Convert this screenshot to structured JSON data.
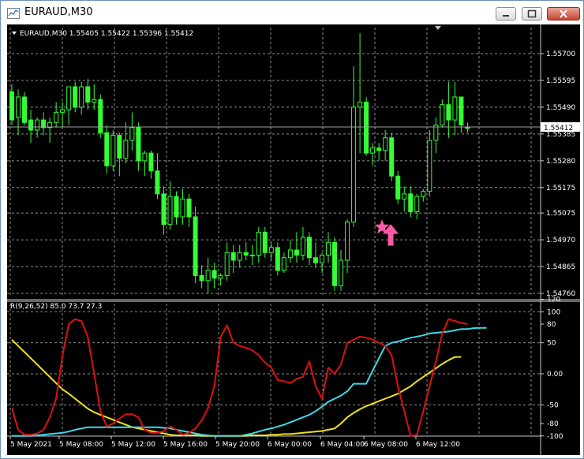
{
  "window": {
    "title": "EURAUD,M30"
  },
  "chart": {
    "header": "EURAUD,M30  1.55405 1.55422 1.55396 1.55412",
    "current_price": "1.55412",
    "price_axis": [
      "1.55700",
      "1.55595",
      "1.55490",
      "1.55385",
      "1.55280",
      "1.55175",
      "1.55075",
      "1.54970",
      "1.54865",
      "1.54760"
    ],
    "time_axis": [
      "5 May 2021",
      "5 May 08:00",
      "5 May 12:00",
      "5 May 16:00",
      "5 May 20:00",
      "6 May 00:00",
      "6 May 04:00",
      "6 May 08:00",
      "6 May 12:00"
    ]
  },
  "indicator": {
    "header": "R(9,26,52) 85.0 73.7 27.3",
    "axis": [
      "120",
      "100",
      "80",
      "50",
      "0.00",
      "-50",
      "-80",
      "-100"
    ]
  },
  "colors": {
    "background": "#000000",
    "candle": "#33ff33",
    "grid": "#8f8f8f",
    "red_line": "#e01010",
    "cyan_line": "#40d8e8",
    "yellow_line": "#f0e020",
    "marker": "#ff5aa8"
  },
  "icons": {
    "marker_star": "star-icon",
    "marker_arrow": "up-arrow-icon"
  },
  "candles": [
    [
      1.5555,
      1.5558,
      1.5542,
      1.5544
    ],
    [
      1.5545,
      1.5556,
      1.5538,
      1.5553
    ],
    [
      1.5553,
      1.5555,
      1.5542,
      1.5543
    ],
    [
      1.5544,
      1.5548,
      1.5535,
      1.554
    ],
    [
      1.554,
      1.5545,
      1.5537,
      1.5544
    ],
    [
      1.5544,
      1.5547,
      1.5538,
      1.5541
    ],
    [
      1.5541,
      1.5545,
      1.5535,
      1.5543
    ],
    [
      1.5543,
      1.5551,
      1.5541,
      1.5547
    ],
    [
      1.5547,
      1.5551,
      1.5541,
      1.5548
    ],
    [
      1.5548,
      1.5556,
      1.5542,
      1.5557
    ],
    [
      1.5557,
      1.5559,
      1.5547,
      1.5549
    ],
    [
      1.5549,
      1.5559,
      1.5546,
      1.5557
    ],
    [
      1.5557,
      1.556,
      1.5548,
      1.5551
    ],
    [
      1.5551,
      1.5558,
      1.5548,
      1.5552
    ],
    [
      1.5552,
      1.5554,
      1.5537,
      1.5539
    ],
    [
      1.5539,
      1.5542,
      1.5523,
      1.5526
    ],
    [
      1.5526,
      1.554,
      1.5524,
      1.5538
    ],
    [
      1.5538,
      1.5539,
      1.5522,
      1.5529
    ],
    [
      1.5529,
      1.5543,
      1.5527,
      1.5536
    ],
    [
      1.5536,
      1.5547,
      1.5532,
      1.5541
    ],
    [
      1.5541,
      1.5543,
      1.5524,
      1.5528
    ],
    [
      1.5528,
      1.5532,
      1.5522,
      1.5531
    ],
    [
      1.5531,
      1.5532,
      1.5521,
      1.5524
    ],
    [
      1.5524,
      1.5531,
      1.5513,
      1.5515
    ],
    [
      1.5515,
      1.5518,
      1.5499,
      1.5503
    ],
    [
      1.5503,
      1.552,
      1.5501,
      1.5514
    ],
    [
      1.5514,
      1.5516,
      1.5503,
      1.5506
    ],
    [
      1.5506,
      1.5517,
      1.5503,
      1.5513
    ],
    [
      1.5513,
      1.5515,
      1.5502,
      1.5506
    ],
    [
      1.5506,
      1.551,
      1.548,
      1.5483
    ],
    [
      1.5483,
      1.5487,
      1.5478,
      1.5481
    ],
    [
      1.5481,
      1.549,
      1.5476,
      1.5485
    ],
    [
      1.5485,
      1.5488,
      1.5478,
      1.5482
    ],
    [
      1.5482,
      1.5484,
      1.5479,
      1.5483
    ],
    [
      1.5483,
      1.5496,
      1.5481,
      1.5492
    ],
    [
      1.5492,
      1.5495,
      1.5484,
      1.5489
    ],
    [
      1.5489,
      1.5495,
      1.5486,
      1.5492
    ],
    [
      1.5492,
      1.5496,
      1.5489,
      1.5491
    ],
    [
      1.5491,
      1.5495,
      1.5487,
      1.5491
    ],
    [
      1.5491,
      1.5502,
      1.5488,
      1.55
    ],
    [
      1.55,
      1.5502,
      1.549,
      1.5492
    ],
    [
      1.5492,
      1.5496,
      1.5489,
      1.5494
    ],
    [
      1.5494,
      1.5496,
      1.5483,
      1.5485
    ],
    [
      1.5485,
      1.5492,
      1.5484,
      1.549
    ],
    [
      1.549,
      1.5497,
      1.5488,
      1.5493
    ],
    [
      1.5493,
      1.55,
      1.5488,
      1.5491
    ],
    [
      1.5491,
      1.5502,
      1.5489,
      1.5498
    ],
    [
      1.5498,
      1.55,
      1.5487,
      1.549
    ],
    [
      1.549,
      1.5496,
      1.5486,
      1.5488
    ],
    [
      1.5488,
      1.5492,
      1.5484,
      1.5491
    ],
    [
      1.5491,
      1.55,
      1.5488,
      1.5496
    ],
    [
      1.5496,
      1.5498,
      1.5477,
      1.5479
    ],
    [
      1.5479,
      1.5493,
      1.5477,
      1.5489
    ],
    [
      1.5489,
      1.5505,
      1.5484,
      1.5504
    ],
    [
      1.5504,
      1.5565,
      1.5502,
      1.5549
    ],
    [
      1.5549,
      1.5578,
      1.5531,
      1.5551
    ],
    [
      1.5551,
      1.5553,
      1.553,
      1.5531
    ],
    [
      1.5531,
      1.5535,
      1.5526,
      1.5533
    ],
    [
      1.5533,
      1.5535,
      1.5528,
      1.5532
    ],
    [
      1.5532,
      1.554,
      1.5528,
      1.5537
    ],
    [
      1.5537,
      1.5539,
      1.552,
      1.5522
    ],
    [
      1.5522,
      1.5524,
      1.5511,
      1.5513
    ],
    [
      1.5513,
      1.5518,
      1.5508,
      1.5515
    ],
    [
      1.5515,
      1.5518,
      1.5506,
      1.5508
    ],
    [
      1.5508,
      1.5515,
      1.5505,
      1.5514
    ],
    [
      1.5514,
      1.5517,
      1.5512,
      1.5516
    ],
    [
      1.5516,
      1.554,
      1.5514,
      1.5536
    ],
    [
      1.5536,
      1.5545,
      1.5531,
      1.5542
    ],
    [
      1.5542,
      1.5552,
      1.5541,
      1.555
    ],
    [
      1.555,
      1.5559,
      1.5537,
      1.5544
    ],
    [
      1.5544,
      1.5559,
      1.5538,
      1.5553
    ],
    [
      1.5553,
      1.5553,
      1.5539,
      1.5542
    ],
    [
      1.5541,
      1.5543,
      1.5539,
      1.5541
    ]
  ],
  "red": [
    -55,
    -90,
    -98,
    -98,
    -96,
    -90,
    -70,
    -40,
    30,
    80,
    88,
    85,
    60,
    0,
    -60,
    -85,
    -80,
    -72,
    -65,
    -65,
    -70,
    -90,
    -95,
    -95,
    -92,
    -85,
    -90,
    -98,
    -95,
    -88,
    -75,
    -55,
    -20,
    60,
    78,
    50,
    45,
    42,
    38,
    30,
    18,
    10,
    -10,
    -12,
    -15,
    -8,
    -5,
    20,
    -20,
    -40,
    10,
    0,
    15,
    50,
    55,
    60,
    58,
    55,
    50,
    45,
    30,
    -20,
    -60,
    -100,
    -98,
    -60,
    -20,
    20,
    65,
    88,
    85,
    82,
    80
  ],
  "cyan": [
    -100,
    -100,
    -100,
    -100,
    -99,
    -98,
    -97,
    -96,
    -95,
    -93,
    -90,
    -88,
    -86,
    -86,
    -86,
    -86,
    -86,
    -86,
    -86,
    -86,
    -86,
    -86,
    -86,
    -86,
    -87,
    -88,
    -90,
    -92,
    -94,
    -96,
    -98,
    -99,
    -100,
    -100,
    -100,
    -100,
    -100,
    -98,
    -96,
    -93,
    -90,
    -88,
    -85,
    -82,
    -78,
    -74,
    -70,
    -66,
    -60,
    -53,
    -45,
    -40,
    -35,
    -28,
    -16,
    -16,
    -16,
    5,
    25,
    45,
    50,
    52,
    55,
    58,
    60,
    62,
    65,
    66,
    67,
    68,
    70,
    72,
    72,
    73.7,
    74,
    74
  ],
  "yellow": [
    55,
    45,
    35,
    25,
    15,
    5,
    -5,
    -15,
    -25,
    -32,
    -40,
    -48,
    -56,
    -62,
    -66,
    -70,
    -74,
    -78,
    -82,
    -86,
    -88,
    -90,
    -92,
    -94,
    -96,
    -98,
    -99,
    -99,
    -99,
    -99,
    -100,
    -100,
    -100,
    -100,
    -100,
    -100,
    -100,
    -100,
    -99,
    -99,
    -99,
    -98,
    -98,
    -97,
    -97,
    -96,
    -95,
    -94,
    -93,
    -92,
    -90,
    -88,
    -80,
    -70,
    -63,
    -57,
    -52,
    -48,
    -44,
    -40,
    -36,
    -32,
    -26,
    -20,
    -12,
    -5,
    2,
    9,
    16,
    22,
    27,
    27.3
  ]
}
